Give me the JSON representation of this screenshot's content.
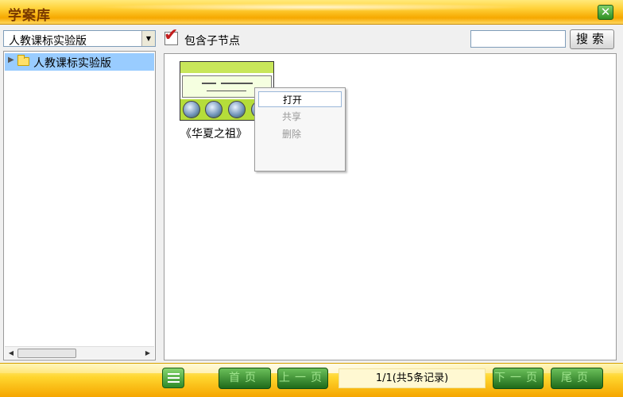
{
  "window": {
    "title": "学案库",
    "close_label": "✕"
  },
  "toolbar": {
    "version_select": "人教课标实验版",
    "include_children_label": "包含子节点",
    "include_children_checked": true,
    "search_placeholder": "",
    "search_label": "搜索"
  },
  "tree": {
    "items": [
      {
        "label": "人教课标实验版",
        "selected": true
      }
    ]
  },
  "content": {
    "items": [
      {
        "caption": "《华夏之祖》"
      }
    ]
  },
  "context_menu": {
    "items": [
      {
        "label": "打开",
        "enabled": true
      },
      {
        "label": "共享",
        "enabled": false
      },
      {
        "label": "删除",
        "enabled": false
      }
    ]
  },
  "pagination": {
    "first_label": "首页",
    "prev_label": "上一页",
    "page_info": "1/1(共5条记录)",
    "next_label": "下一页",
    "last_label": "尾页"
  },
  "colors": {
    "title_bar": "#ffd23a",
    "selected_row": "#99ccff",
    "nav_button": "#2f8a2a",
    "checkmark": "#c21d1d"
  }
}
